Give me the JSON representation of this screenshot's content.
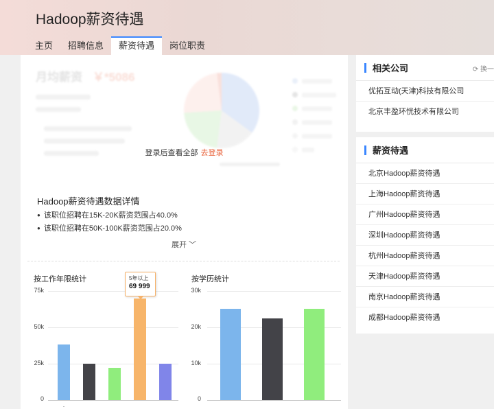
{
  "header": {
    "title": "Hadoop薪资待遇",
    "tabs": [
      {
        "label": "主页",
        "active": false
      },
      {
        "label": "招聘信息",
        "active": false
      },
      {
        "label": "薪资待遇",
        "active": true
      },
      {
        "label": "岗位职责",
        "active": false
      }
    ]
  },
  "salary": {
    "title": "月均薪资",
    "amount": "￥*5086",
    "login_tip": "登录后查看全部",
    "login_link": "去登录"
  },
  "details": {
    "title": "Hadoop薪资待遇数据详情",
    "items": [
      "该职位招聘在15K-20K薪资范围占40.0%",
      "该职位招聘在50K-100K薪资范围占20.0%"
    ],
    "expand_label": "展开 ﹀"
  },
  "charts": {
    "experience_title": "按工作年限统计",
    "education_title": "按学历统计",
    "tooltip_label": "5年以上",
    "tooltip_value": "69 999"
  },
  "chart_data": [
    {
      "type": "bar",
      "title": "按工作年限统计",
      "yticks": [
        "75k",
        "50k",
        "25k",
        "0"
      ],
      "ylim": [
        0,
        75000
      ],
      "series": [
        {
          "values": [
            38000,
            25000,
            22000,
            69999,
            25000
          ]
        }
      ],
      "colors": [
        "#7cb5ec",
        "#434348",
        "#90ed7d",
        "#f7b56a",
        "#8085e9"
      ],
      "grid": true
    },
    {
      "type": "bar",
      "title": "按学历统计",
      "yticks": [
        "30k",
        "20k",
        "10k",
        "0"
      ],
      "ylim": [
        0,
        30000
      ],
      "series": [
        {
          "values": [
            25000,
            22500,
            25000
          ]
        }
      ],
      "colors": [
        "#7cb5ec",
        "#434348",
        "#90ed7d"
      ],
      "grid": true
    }
  ],
  "sidebar": {
    "related": {
      "title": "相关公司",
      "refresh_label": "换一",
      "items": [
        "优拓互动(天津)科技有限公司",
        "北京丰盈环恍技术有限公司"
      ]
    },
    "salary": {
      "title": "薪资待遇",
      "items": [
        "北京Hadoop薪资待遇",
        "上海Hadoop薪资待遇",
        "广州Hadoop薪资待遇",
        "深圳Hadoop薪资待遇",
        "杭州Hadoop薪资待遇",
        "天津Hadoop薪资待遇",
        "南京Hadoop薪资待遇",
        "成都Hadoop薪资待遇"
      ]
    }
  }
}
